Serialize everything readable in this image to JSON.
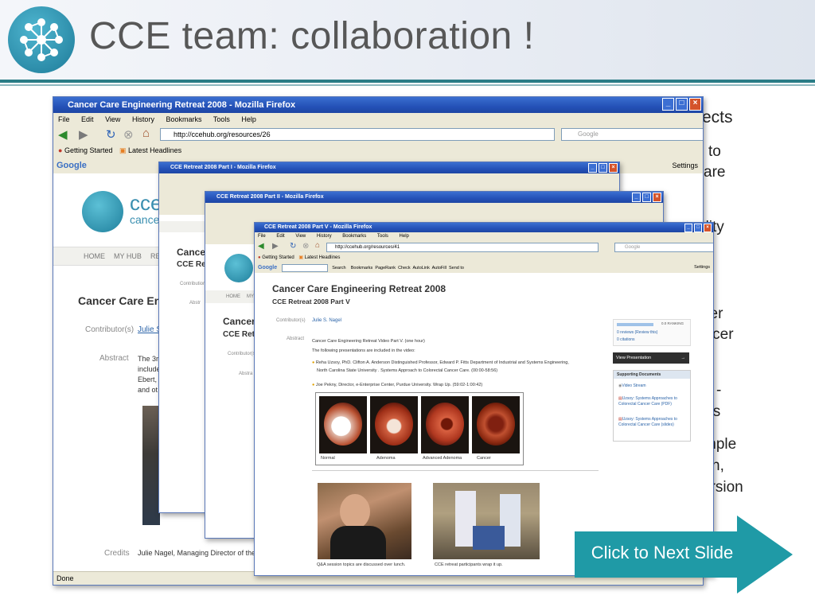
{
  "slide": {
    "title": "CCE team: collaboration !",
    "next_button": "Click to Next Slide",
    "bullet_fragments": [
      "ects",
      "to",
      "are",
      "ality",
      "cer",
      "ancer",
      "-",
      "sis",
      "mple",
      "n,",
      "ersion"
    ]
  },
  "window1": {
    "title": "Cancer Care Engineering Retreat 2008 - Mozilla Firefox",
    "menu": [
      "File",
      "Edit",
      "View",
      "History",
      "Bookmarks",
      "Tools",
      "Help"
    ],
    "url": "http://ccehub.org/resources/26",
    "search_placeholder": "Google",
    "bookmarks": [
      "Getting Started",
      "Latest Headlines"
    ],
    "google_label": "Google",
    "settings": "Settings",
    "site_logo_text": "cce",
    "site_logo_sub": "cancer",
    "nav": [
      "HOME",
      "MY HUB",
      "RE"
    ],
    "heading": "Cancer Care Eng",
    "contributor_label": "Contributor(s)",
    "contributor_value": "Julie S",
    "abstract_label": "Abstract",
    "abstract_lines": [
      "The 3r",
      "include",
      "Ebert,",
      "and ot"
    ],
    "credits_label": "Credits",
    "credits_value": "Julie Nagel, Managing Director of the",
    "status": "Done"
  },
  "window2": {
    "title": "CCE Retreat 2008 Part I - Mozilla Firefox",
    "heading": "Cancer",
    "subheading": "CCE Ret",
    "contributor_label": "Contribution",
    "abstract_label": "Abstr"
  },
  "window3": {
    "title": "CCE Retreat 2008 Part II - Mozilla Firefox",
    "heading": "Cancer",
    "subheading": "CCE Retr",
    "contributor_label": "Contributor(s)",
    "abstract_label": "Abstra",
    "nav": [
      "HOME",
      "MY"
    ]
  },
  "window4": {
    "title": "CCE Retreat 2008 Part V - Mozilla Firefox",
    "menu": [
      "File",
      "Edit",
      "View",
      "History",
      "Bookmarks",
      "Tools",
      "Help"
    ],
    "url": "http://ccehub.org/resources/41",
    "search_placeholder": "Google",
    "bookmarks": [
      "Getting Started",
      "Latest Headlines"
    ],
    "toolbar_items": [
      "Search",
      "Bookmarks",
      "PageRank",
      "Check",
      "AutoLink",
      "AutoFill",
      "Send to",
      "Settings"
    ],
    "heading": "Cancer Care Engineering Retreat 2008",
    "subheading": "CCE Retreat 2008 Part V",
    "contributor_label": "Contributor(s)",
    "contributor_value": "Julie S. Nagel",
    "abstract_label": "Abstract",
    "abstract_line1": "Cancer Care Engineering Retreat Video Part V. (one hour)",
    "abstract_line2": "The following presentations are included in the video:",
    "bullet1_line1": "Reha Uzsoy, PhD. Clifton A. Anderson Distinguished Professor, Edward P. Fitts Department of Industrial and Systems Engineering,",
    "bullet1_line2": "North Carolina State University . Systems Approach to Colorectal Cancer Care. (00:00-58:56)",
    "bullet2": "Joe Pekny, Director, e-Enterprise Center, Purdue University. Wrap Up. (59:02-1:00:42)",
    "stages": [
      "Normal",
      "Adenoma",
      "Advanced Adenoma",
      "Cancer"
    ],
    "caption_left": "Q&A session topics are discussed over lunch.",
    "caption_right": "CCE retreat participants wrap it up.",
    "ranking": "0.0 RANKING",
    "reviews": "0 reviews (Review this)",
    "citations": "0 citations",
    "view_presentation": "View Presentation",
    "supporting_docs": "Supporting Documents",
    "docs": [
      "Video Stream",
      "Uzsoy: Systems Approaches to Colorectal Cancer Care (PDF)",
      "Uzsoy: Systems Approaches to Colorectal Cancer Care (slides)"
    ]
  },
  "colors": {
    "title_rule": "#2a7c86",
    "next_arrow": "#1f9aa6",
    "titlebar": "#2451b7",
    "link": "#2a63a8"
  }
}
